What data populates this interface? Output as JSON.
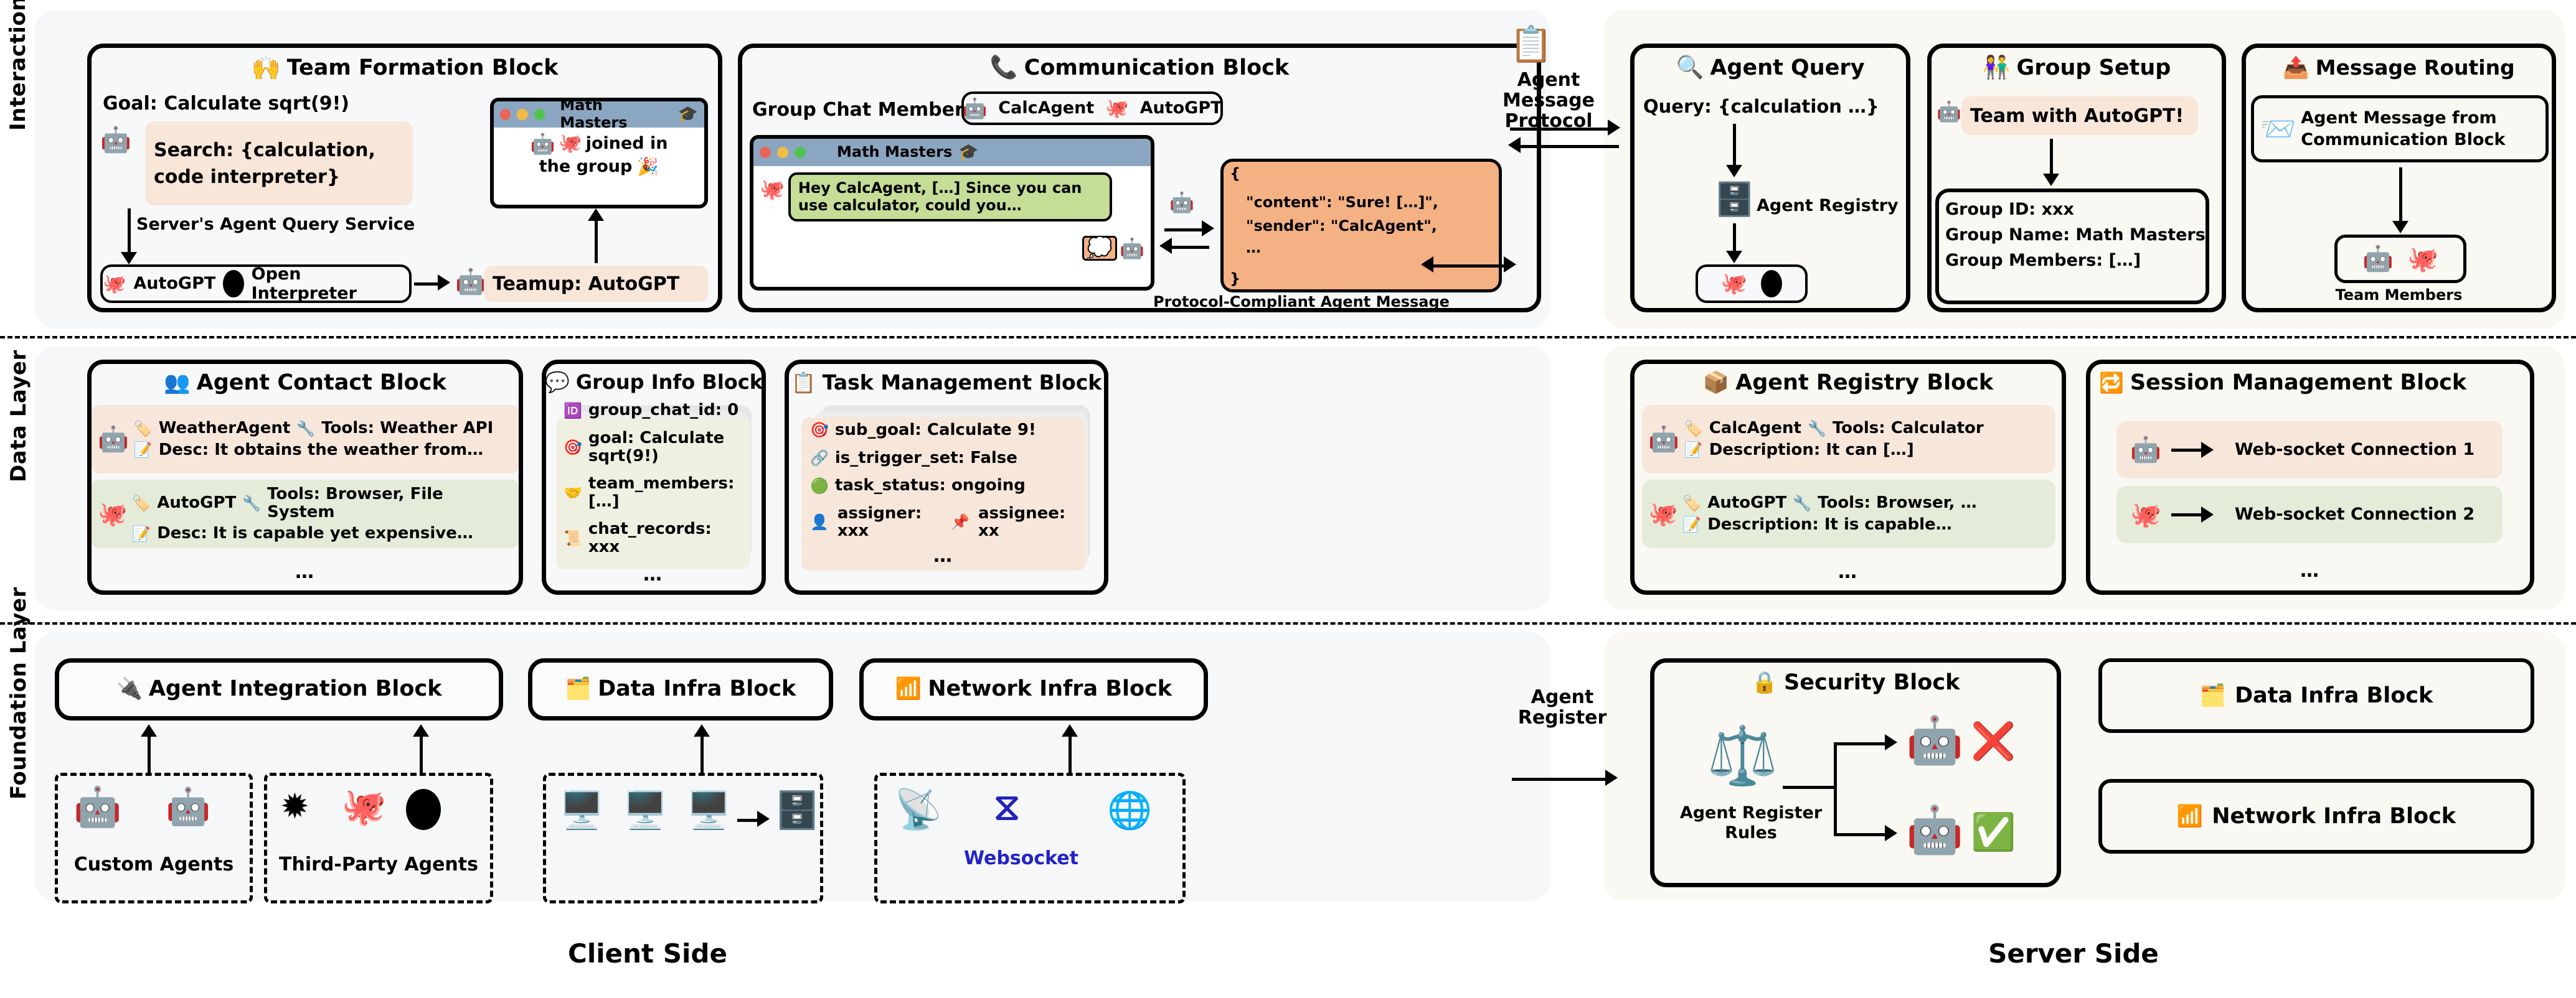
{
  "layers": [
    {
      "label": "Interaction Layer"
    },
    {
      "label": "Data Layer"
    },
    {
      "label": "Foundation Layer"
    }
  ],
  "bottom_captions": {
    "client": "Client Side",
    "server": "Server Side"
  },
  "connectors": {
    "agent_message_protocol": "Agent\nMessage\nProtocol",
    "agent_message_protocol_l1": "Agent",
    "agent_message_protocol_l2": "Message",
    "agent_message_protocol_l3": "Protocol",
    "agent_register_l1": "Agent",
    "agent_register_l2": "Register"
  },
  "interaction": {
    "team_formation": {
      "title": "Team Formation Block",
      "title_icon": "raising-hands-emoji",
      "goal": "Goal: Calculate sqrt(9!)",
      "search_line1": "Search: {calculation,",
      "search_line2": "code interpreter}",
      "service_label": "Server's Agent Query Service",
      "result_pill": {
        "agent1": "AutoGPT",
        "agent2": "Open Interpreter"
      },
      "teamup": "Teamup: AutoGPT",
      "chat": {
        "title": "Math Masters",
        "body_line1": "joined in",
        "body_line2": "the group"
      }
    },
    "communication": {
      "title": "Communication Block",
      "title_icon": "telephone-emoji",
      "members_label": "Group Chat Members:",
      "members": [
        "CalcAgent",
        "AutoGPT"
      ],
      "chat": {
        "title": "Math Masters",
        "message": "Hey CalcAgent, […] Since you can use calculator, could you…"
      },
      "json": {
        "open_brace": "{",
        "line1": "\"content\": \"Sure! […]\",",
        "line2": "\"sender\": \"CalcAgent\",",
        "line3": "…",
        "close_brace": "}"
      },
      "protocol_caption": "Protocol-Compliant Agent Message"
    },
    "agent_query": {
      "title": "Agent Query",
      "title_icon": "magnifier-emoji",
      "query": "Query: {calculation …}",
      "registry_label": "Agent Registry"
    },
    "group_setup": {
      "title": "Group Setup",
      "title_icon": "two-people-emoji",
      "prompt": "Team with AutoGPT!",
      "fields": [
        "Group ID: xxx",
        "Group Name: Math Masters",
        "Group Members: […]"
      ]
    },
    "message_routing": {
      "title": "Message Routing",
      "title_icon": "inbox-tray-emoji",
      "msg_line1": "Agent Message from",
      "msg_line2": "Communication Block",
      "team_members_caption": "Team Members"
    }
  },
  "data_layer": {
    "agent_contact": {
      "title": "Agent Contact Block",
      "title_icon": "busts-in-silhouette-emoji",
      "entries": [
        {
          "name": "WeatherAgent",
          "tools": "Tools: Weather API",
          "desc": "Desc: It obtains the weather from…"
        },
        {
          "name": "AutoGPT",
          "tools": "Tools: Browser, File System",
          "desc": "Desc: It is capable yet expensive…"
        }
      ],
      "more": "…"
    },
    "group_info": {
      "title": "Group Info Block",
      "title_icon": "speech-balloon-emoji",
      "fields": [
        {
          "icon": "id-emoji",
          "text": "group_chat_id: 0"
        },
        {
          "icon": "dart-emoji",
          "text": "goal: Calculate sqrt(9!)"
        },
        {
          "icon": "handshake-emoji",
          "text": "team_members: […]"
        },
        {
          "icon": "scroll-emoji",
          "text": "chat_records: xxx"
        }
      ],
      "more": "…"
    },
    "task_management": {
      "title": "Task Management Block",
      "title_icon": "clipboard-emoji",
      "fields": [
        {
          "icon": "dart-emoji",
          "text": "sub_goal: Calculate 9!"
        },
        {
          "icon": "link-emoji",
          "text": "is_trigger_set: False"
        },
        {
          "icon": "green-circle-emoji",
          "text": "task_status: ongoing"
        }
      ],
      "assigner": "assigner: xxx",
      "assignee": "assignee: xx",
      "more": "…"
    },
    "agent_registry": {
      "title": "Agent Registry Block",
      "title_icon": "package-emoji",
      "entries": [
        {
          "name": "CalcAgent",
          "tools": "Tools: Calculator",
          "desc": "Description: It can […]"
        },
        {
          "name": "AutoGPT",
          "tools": "Tools: Browser, …",
          "desc": "Description: It is capable…"
        }
      ],
      "more": "…"
    },
    "session_management": {
      "title": "Session Management Block",
      "title_icon": "repeat-emoji",
      "entries": [
        {
          "icon": "robot-headset-icon",
          "label": "Web-socket Connection 1"
        },
        {
          "icon": "autogpt-octopus-icon",
          "label": "Web-socket Connection 2"
        }
      ],
      "more": "…"
    }
  },
  "foundation": {
    "agent_integration": {
      "title": "Agent Integration Block",
      "title_icon": "electric-plug-emoji",
      "groups": [
        {
          "caption": "Custom Agents",
          "icons": [
            "robot-headset-icon",
            "robot-antenna-icon"
          ]
        },
        {
          "caption": "Third-Party Agents",
          "icons": [
            "openai-logo-icon",
            "autogpt-octopus-icon",
            "open-interpreter-icon"
          ]
        }
      ]
    },
    "data_infra": {
      "title": "Data Infra Block",
      "title_icon": "card-index-dividers-emoji",
      "icons": [
        "server-rack-icon",
        "server-rack-icon",
        "server-rack-icon",
        "database-icon"
      ]
    },
    "network_infra": {
      "title": "Network Infra Block",
      "title_icon": "bar-chart-emoji",
      "icons": [
        "wifi-signal-icon",
        "websocket-logo-icon",
        "secure-globe-icon"
      ],
      "websocket_label": "Websocket"
    },
    "security": {
      "title": "Security Block",
      "title_icon": "lock-emoji",
      "rules_caption_l1": "Agent Register",
      "rules_caption_l2": "Rules",
      "outcomes": [
        {
          "icon": "evil-robot-icon",
          "status": "reject",
          "status_icon": "cross-mark-emoji"
        },
        {
          "icon": "friendly-robot-icon",
          "status": "accept",
          "status_icon": "check-mark-emoji"
        }
      ]
    },
    "server_stubs": [
      {
        "title": "Data Infra Block",
        "title_icon": "card-index-dividers-emoji"
      },
      {
        "title": "Network Infra Block",
        "title_icon": "bar-chart-emoji"
      }
    ]
  },
  "colors": {
    "peach": "#f7e6da",
    "green_row": "#e4ebd8",
    "chat_bar": "#8ba6c1",
    "green_bubble": "#c5dd96",
    "json_orange": "#f4b183",
    "teal": "#0e8f8f",
    "panel_client": "#f6f7f9",
    "panel_server": "#faf8f2"
  }
}
